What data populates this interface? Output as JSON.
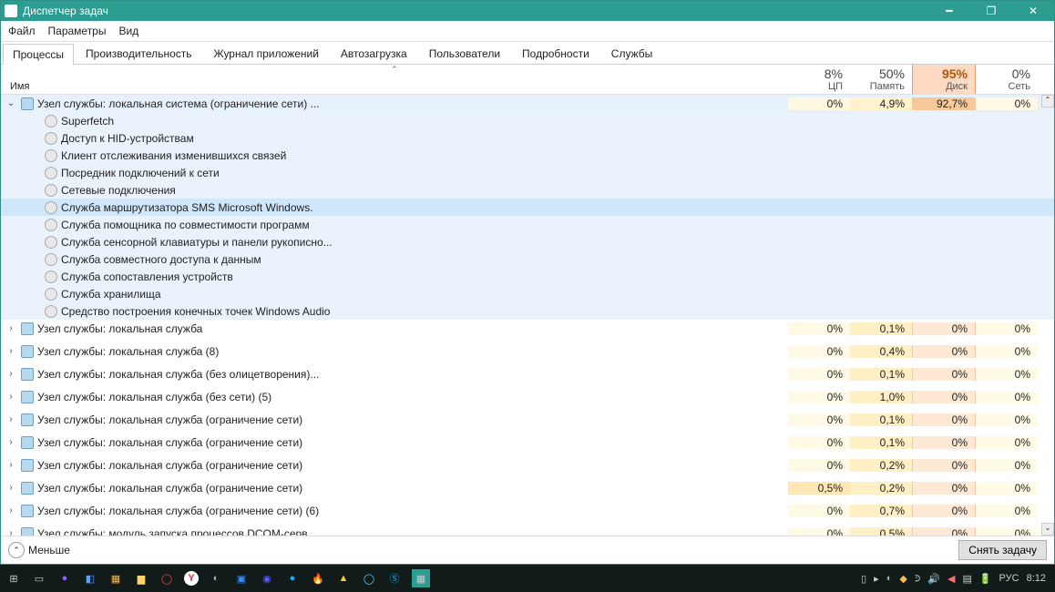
{
  "title": "Диспетчер задач",
  "menus": [
    "Файл",
    "Параметры",
    "Вид"
  ],
  "tabs": [
    "Процессы",
    "Производительность",
    "Журнал приложений",
    "Автозагрузка",
    "Пользователи",
    "Подробности",
    "Службы"
  ],
  "active_tab": 0,
  "columns": {
    "name": "Имя",
    "metrics": [
      {
        "pct": "8%",
        "label": "ЦП",
        "key": "cpu"
      },
      {
        "pct": "50%",
        "label": "Память",
        "key": "mem"
      },
      {
        "pct": "95%",
        "label": "Диск",
        "key": "disk",
        "hot": true
      },
      {
        "pct": "0%",
        "label": "Сеть",
        "key": "net"
      }
    ]
  },
  "expanded_group": {
    "name": "Узел службы: локальная система (ограничение сети) ...",
    "cpu": "0%",
    "mem": "4,9%",
    "disk": "92,7%",
    "net": "0%",
    "children": [
      "Superfetch",
      "Доступ к HID-устройствам",
      "Клиент отслеживания изменившихся связей",
      "Посредник подключений к сети",
      "Сетевые подключения",
      "Служба маршрутизатора SMS Microsoft Windows.",
      "Служба помощника по совместимости программ",
      "Служба сенсорной клавиатуры и панели рукописно...",
      "Служба совместного доступа к данным",
      "Служба сопоставления устройств",
      "Служба хранилища",
      "Средство построения конечных точек Windows Audio"
    ],
    "selected_child": 5
  },
  "groups": [
    {
      "name": "Узел службы: локальная служба",
      "cpu": "0%",
      "mem": "0,1%",
      "disk": "0%",
      "net": "0%"
    },
    {
      "name": "Узел службы: локальная служба (8)",
      "cpu": "0%",
      "mem": "0,4%",
      "disk": "0%",
      "net": "0%"
    },
    {
      "name": "Узел службы: локальная служба (без олицетворения)...",
      "cpu": "0%",
      "mem": "0,1%",
      "disk": "0%",
      "net": "0%"
    },
    {
      "name": "Узел службы: локальная служба (без сети) (5)",
      "cpu": "0%",
      "mem": "1,0%",
      "disk": "0%",
      "net": "0%"
    },
    {
      "name": "Узел службы: локальная служба (ограничение сети)",
      "cpu": "0%",
      "mem": "0,1%",
      "disk": "0%",
      "net": "0%"
    },
    {
      "name": "Узел службы: локальная служба (ограничение сети)",
      "cpu": "0%",
      "mem": "0,1%",
      "disk": "0%",
      "net": "0%"
    },
    {
      "name": "Узел службы: локальная служба (ограничение сети)",
      "cpu": "0%",
      "mem": "0,2%",
      "disk": "0%",
      "net": "0%"
    },
    {
      "name": "Узел службы: локальная служба (ограничение сети)",
      "cpu": "0,5%",
      "mem": "0,2%",
      "disk": "0%",
      "net": "0%",
      "hot": true
    },
    {
      "name": "Узел службы: локальная служба (ограничение сети) (6)",
      "cpu": "0%",
      "mem": "0,7%",
      "disk": "0%",
      "net": "0%"
    },
    {
      "name": "Узел службы: модуль запуска процессов DCOM-серв...",
      "cpu": "0%",
      "mem": "0,5%",
      "disk": "0%",
      "net": "0%"
    }
  ],
  "footer": {
    "less": "Меньше",
    "end_task": "Снять задачу"
  },
  "tray": {
    "lang": "РУС",
    "time": "8:12"
  }
}
